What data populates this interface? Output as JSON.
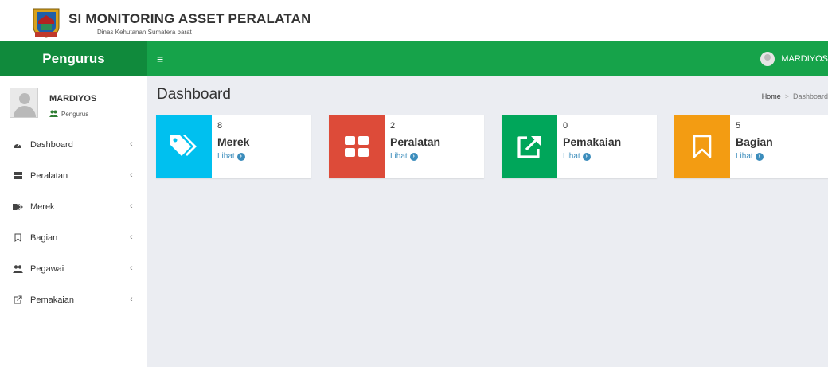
{
  "header": {
    "title": "SI MONITORING ASSET PERALATAN",
    "subtitle": "Dinas Kehutanan Sumatera barat",
    "logo_icon": "provincial-emblem-icon"
  },
  "navbar": {
    "brand": "Pengurus",
    "menu_toggle": "≡",
    "user_name": "MARDIYOS",
    "color": "#16a34a",
    "brand_color": "#108a3c"
  },
  "profile": {
    "name": "MARDIYOS",
    "role": "Pengurus"
  },
  "sidebar": {
    "items": [
      {
        "label": "Dashboard",
        "icon": "dashboard-icon"
      },
      {
        "label": "Peralatan",
        "icon": "grid-icon"
      },
      {
        "label": "Merek",
        "icon": "tags-icon"
      },
      {
        "label": "Bagian",
        "icon": "bookmark-icon"
      },
      {
        "label": "Pegawai",
        "icon": "users-icon"
      },
      {
        "label": "Pemakaian",
        "icon": "external-link-icon"
      }
    ]
  },
  "main": {
    "page_title": "Dashboard",
    "breadcrumb": {
      "home": "Home",
      "current": "Dashboard"
    },
    "cards": [
      {
        "count": "8",
        "label": "Merek",
        "link": "Lihat",
        "icon": "tags-icon",
        "color": "#00c0ef"
      },
      {
        "count": "2",
        "label": "Peralatan",
        "link": "Lihat",
        "icon": "grid-icon",
        "color": "#dd4b39"
      },
      {
        "count": "0",
        "label": "Pemakaian",
        "link": "Lihat",
        "icon": "external-link-icon",
        "color": "#00a65a"
      },
      {
        "count": "5",
        "label": "Bagian",
        "link": "Lihat",
        "icon": "bookmark-icon",
        "color": "#f39c12"
      }
    ]
  }
}
